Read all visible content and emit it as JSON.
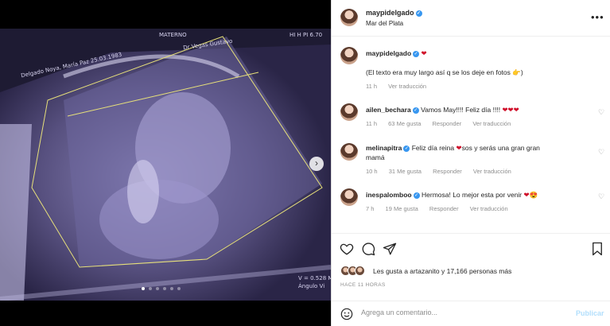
{
  "post": {
    "username": "maypidelgado",
    "location": "Mar del Plata"
  },
  "ultrasound_overlay": {
    "header_line1": "MATERNO",
    "header_line2": "Dr Vegas Gustavo",
    "patient": "Delgado Noya, María Paz 25.03.1983",
    "side_values": "HI H PI 6.70",
    "footer_values": "V = 0.528 MI",
    "footer_label": "Ángulo Vi"
  },
  "comments": [
    {
      "user": "maypidelgado",
      "text": "",
      "time": "",
      "likes": "",
      "reply": "",
      "translate": ""
    },
    {
      "user": "",
      "text": "(El texto era muy largo así q se los deje en fotos 👉)",
      "time": "11 h",
      "likes": "",
      "reply": "",
      "translate": "Ver traducción"
    },
    {
      "user": "ailen_bechara",
      "text": "Vamos May!!!! Feliz día !!!!",
      "time": "11 h",
      "likes": "63 Me gusta",
      "reply": "Responder",
      "translate": "Ver traducción"
    },
    {
      "user": "melinapitra",
      "text": "Feliz día reina",
      "text2": "sos y serás una gran gran",
      "text3": "mamá",
      "time": "10 h",
      "likes": "31 Me gusta",
      "reply": "Responder",
      "translate": "Ver traducción"
    },
    {
      "user": "inespalomboo",
      "text": "Hermosa! Lo mejor esta por venir",
      "time": "7 h",
      "likes": "19 Me gusta",
      "reply": "Responder",
      "translate": "Ver traducción"
    }
  ],
  "likes_text": "Les gusta a artazanito y 17,166 personas más",
  "posted_ago": "HACE 11 HORAS",
  "comment_placeholder": "Agrega un comentario...",
  "publish_label": "Publicar",
  "colors": {
    "verified": "#3897f0",
    "heart": "#d0102a",
    "meta": "#8e8e8e",
    "publish_disabled": "#b2dffc"
  },
  "icons": [
    "more-options-icon",
    "like-icon",
    "comment-icon",
    "share-icon",
    "save-icon",
    "emoji-icon",
    "carousel-next-icon"
  ]
}
